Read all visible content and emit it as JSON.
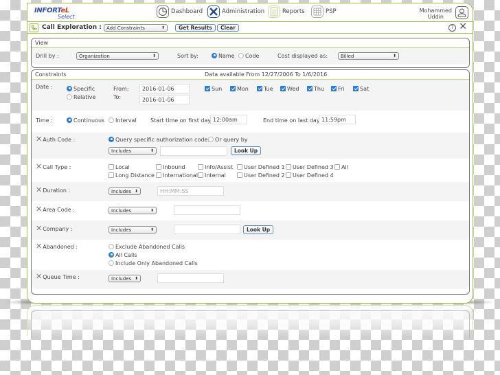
{
  "header": {
    "logo_main": "INFORT",
    "logo_accent": "eL",
    "logo_sub": "Select",
    "nav": [
      {
        "label": "Dashboard",
        "icon": "dashboard-icon"
      },
      {
        "label": "Administration",
        "icon": "tools-icon"
      },
      {
        "label": "Reports",
        "icon": "reports-icon"
      },
      {
        "label": "PSP",
        "icon": "grid-icon"
      }
    ],
    "user_first": "Mohammed",
    "user_last": "Uddin"
  },
  "toolbar": {
    "title": "Call Exploration :",
    "constraints_select": "Add Constraints",
    "get_results": "Get Results",
    "clear": "Clear",
    "help": "?",
    "close": "✕"
  },
  "view": {
    "heading": "View",
    "drill_label": "Drill by :",
    "drill_value": "Organization",
    "sort_label": "Sort by:",
    "sort_options": [
      {
        "label": "Name",
        "checked": true
      },
      {
        "label": "Code",
        "checked": false
      }
    ],
    "cost_label": "Cost displayed as:",
    "cost_value": "Billed"
  },
  "constraints": {
    "heading": "Constraints",
    "availability": "Data available From 12/27/2006 To 1/6/2016",
    "date": {
      "label": "Date :",
      "modes": [
        {
          "label": "Specific",
          "checked": true
        },
        {
          "label": "Relative",
          "checked": false
        }
      ],
      "from_label": "From:",
      "to_label": "To:",
      "from_value": "2016-01-06",
      "to_value": "2016-01-06",
      "days": [
        {
          "label": "Sun",
          "checked": true
        },
        {
          "label": "Mon",
          "checked": true
        },
        {
          "label": "Tue",
          "checked": true
        },
        {
          "label": "Wed",
          "checked": true
        },
        {
          "label": "Thu",
          "checked": true
        },
        {
          "label": "Fri",
          "checked": true
        },
        {
          "label": "Sat",
          "checked": true
        }
      ]
    },
    "time": {
      "label": "Time :",
      "modes": [
        {
          "label": "Continuous",
          "checked": true
        },
        {
          "label": "Interval",
          "checked": false
        }
      ],
      "start_label": "Start time on first day:",
      "start_value": "12:00am",
      "end_label": "End time on last day:",
      "end_value": "11:59pm"
    },
    "auth_code": {
      "label": "Auth Code :",
      "options": [
        {
          "label": "Query specific authorization codes",
          "checked": true
        },
        {
          "label": "Or query by",
          "checked": false
        }
      ],
      "select": "Includes",
      "value": "",
      "lookup": "Look Up"
    },
    "call_type": {
      "label": "Call Type :",
      "row1": [
        "Local",
        "Inbound",
        "Info/Assist",
        "User Defined 1",
        "User Defined 3",
        "All"
      ],
      "row2": [
        "Long Distance",
        "International",
        "Internal",
        "User Defined 2",
        "User Defined 4"
      ]
    },
    "duration": {
      "label": "Duration :",
      "select": "Includes",
      "placeholder": "HH:MM:SS"
    },
    "area_code": {
      "label": "Area Code :",
      "select": "Includes",
      "value": ""
    },
    "company": {
      "label": "Company :",
      "select": "Includes",
      "value": "",
      "lookup": "Look Up"
    },
    "abandoned": {
      "label": "Abandoned :",
      "options": [
        {
          "label": "Exclude Abandoned Calls",
          "checked": false
        },
        {
          "label": "All Calls",
          "checked": true
        },
        {
          "label": "Include Only Abandoned Calls",
          "checked": false
        }
      ]
    },
    "queue_time": {
      "label": "Queue Time :",
      "select": "Includes",
      "value": ""
    }
  },
  "colors": {
    "accent_green": "#9cc54a",
    "radio_blue": "#2a7dd6",
    "button_border": "#5a8ac6"
  }
}
